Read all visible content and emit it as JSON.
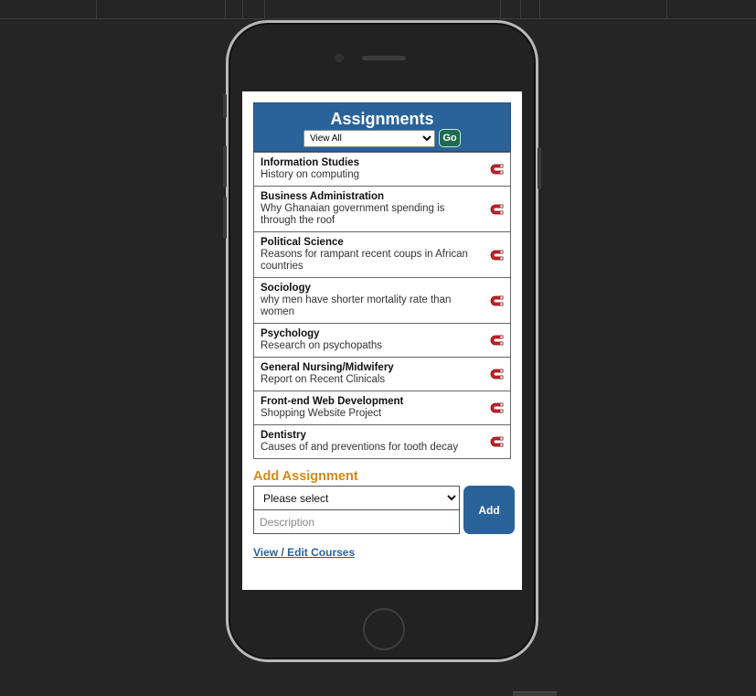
{
  "header": {
    "title": "Assignments",
    "filter_selected": "View All",
    "go_label": "Go"
  },
  "assignments": [
    {
      "course": "Information Studies",
      "description": "History on computing"
    },
    {
      "course": "Business Administration",
      "description": "Why Ghanaian government spending is through the roof"
    },
    {
      "course": "Political Science",
      "description": "Reasons for rampant recent coups in African countries"
    },
    {
      "course": "Sociology",
      "description": "why men have shorter mortality rate than women"
    },
    {
      "course": "Psychology",
      "description": "Research on psychopaths"
    },
    {
      "course": "General Nursing/Midwifery",
      "description": "Report on Recent Clinicals"
    },
    {
      "course": "Front-end Web Development",
      "description": "Shopping Website Project"
    },
    {
      "course": "Dentistry",
      "description": "Causes of and preventions for tooth decay"
    }
  ],
  "add": {
    "title": "Add Assignment",
    "course_select_selected": "Please select",
    "description_placeholder": "Description",
    "add_label": "Add"
  },
  "links": {
    "courses_label": "View / Edit Courses"
  },
  "icons": {
    "remove": "magnet-icon"
  },
  "colors": {
    "header_bg": "#2a6399",
    "accent_orange": "#d08b1a",
    "go_button": "#1e6b4f",
    "magnet_red": "#d0202a"
  }
}
